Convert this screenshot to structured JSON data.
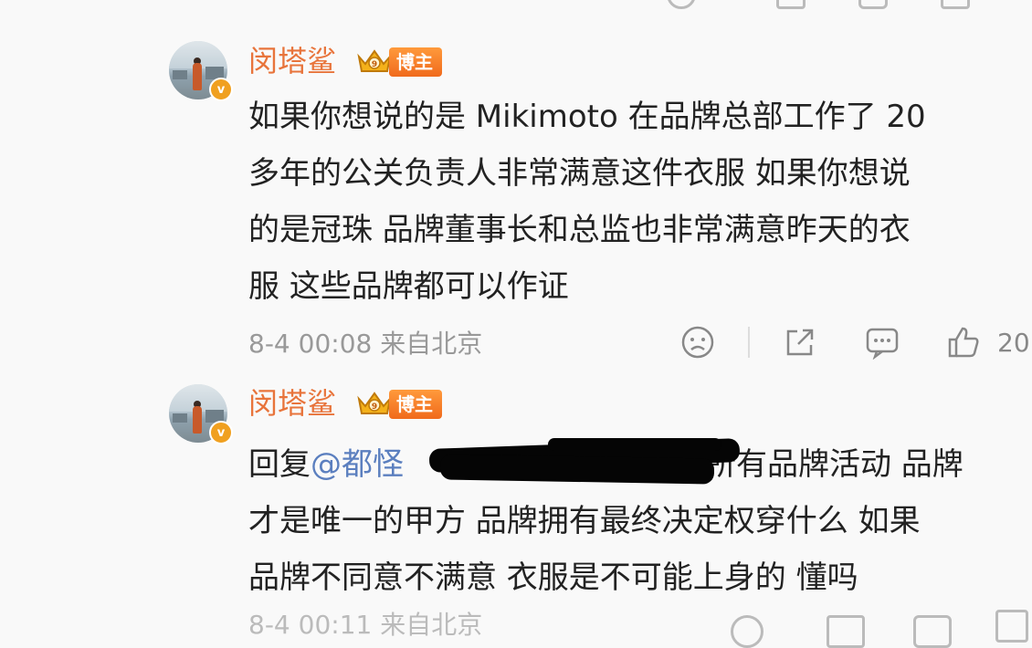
{
  "comments": [
    {
      "username": "闵塔鲨",
      "badge": "博主",
      "avatar_badge": "v",
      "lines": [
        "如果你想说的是 Mikimoto 在品牌总部工作了 20",
        "多年的公关负责人非常满意这件衣服 如果你想说",
        "的是冠珠 品牌董事长和总监也非常满意昨天的衣",
        "服 这些品牌都可以作证"
      ],
      "timestamp": "8-4 00:08",
      "location": "来自北京",
      "like_count": "20"
    },
    {
      "username": "闵塔鲨",
      "badge": "博主",
      "avatar_badge": "v",
      "reply_prefix": "回复",
      "mention": "@都怪",
      "line1_rest": "所有品牌活动 品牌",
      "lines_after": [
        "才是唯一的甲方 品牌拥有最终决定权穿什么 如果",
        "品牌不同意不满意 衣服是不可能上身的 懂吗"
      ],
      "timestamp_partial": "8-4 00:11 来自北京"
    }
  ],
  "icons": [
    "dislike-face-icon",
    "share-icon",
    "comment-icon",
    "thumbs-up-icon"
  ],
  "colors": {
    "username": "#e8743b",
    "mention": "#5b7fbf",
    "meta": "#999999",
    "badge": "#f06a1c"
  }
}
